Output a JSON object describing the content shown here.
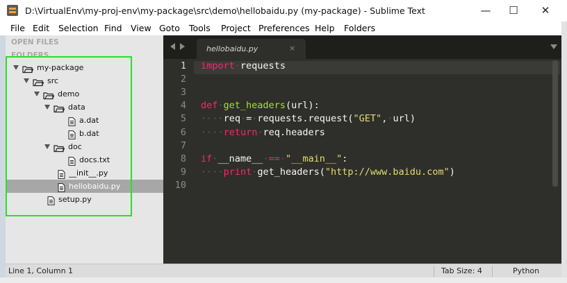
{
  "window": {
    "title": "D:\\VirtualEnv\\my-proj-env\\my-package\\src\\demo\\hellobaidu.py (my-package) - Sublime Text",
    "controls": {
      "minimize": "—",
      "maximize": "☐",
      "close": "✕"
    }
  },
  "menu": [
    "File",
    "Edit",
    "Selection",
    "Find",
    "View",
    "Goto",
    "Tools",
    "Project",
    "Preferences",
    "Help",
    "Folders"
  ],
  "sidebar": {
    "open_files_heading": "OPEN FILES",
    "folders_heading": "FOLDERS",
    "tree": [
      {
        "label": "my-package",
        "type": "folder",
        "depth": 0,
        "expanded": true
      },
      {
        "label": "src",
        "type": "folder",
        "depth": 1,
        "expanded": true
      },
      {
        "label": "demo",
        "type": "folder",
        "depth": 2,
        "expanded": true
      },
      {
        "label": "data",
        "type": "folder",
        "depth": 3,
        "expanded": true
      },
      {
        "label": "a.dat",
        "type": "file",
        "depth": 4
      },
      {
        "label": "b.dat",
        "type": "file",
        "depth": 4
      },
      {
        "label": "doc",
        "type": "folder",
        "depth": 3,
        "expanded": true
      },
      {
        "label": "docs.txt",
        "type": "file",
        "depth": 4
      },
      {
        "label": "__init__.py",
        "type": "file",
        "depth": 3
      },
      {
        "label": "hellobaidu.py",
        "type": "file",
        "depth": 3,
        "selected": true
      },
      {
        "label": "setup.py",
        "type": "file",
        "depth": 2
      }
    ]
  },
  "editor": {
    "tab_label": "hellobaidu.py",
    "tab_close": "×",
    "active_line": 1,
    "line_numbers": [
      "1",
      "2",
      "3",
      "4",
      "5",
      "6",
      "7",
      "8",
      "9",
      "10"
    ],
    "lines": [
      "import requests",
      "",
      "",
      "def get_headers(url):",
      "    req = requests.request(\"GET\", url)",
      "    return req.headers",
      "",
      "if __name__ == \"__main__\":",
      "    print get_headers(\"http://www.baidu.com\")",
      ""
    ]
  },
  "status": {
    "position": "Line 1, Column 1",
    "tab_size": "Tab Size: 4",
    "syntax": "Python"
  },
  "colors": {
    "editor_bg": "#2e2f2a",
    "keyword": "#f92672",
    "function": "#a6e22e",
    "string": "#e6db74",
    "highlight_box": "#28e028"
  }
}
